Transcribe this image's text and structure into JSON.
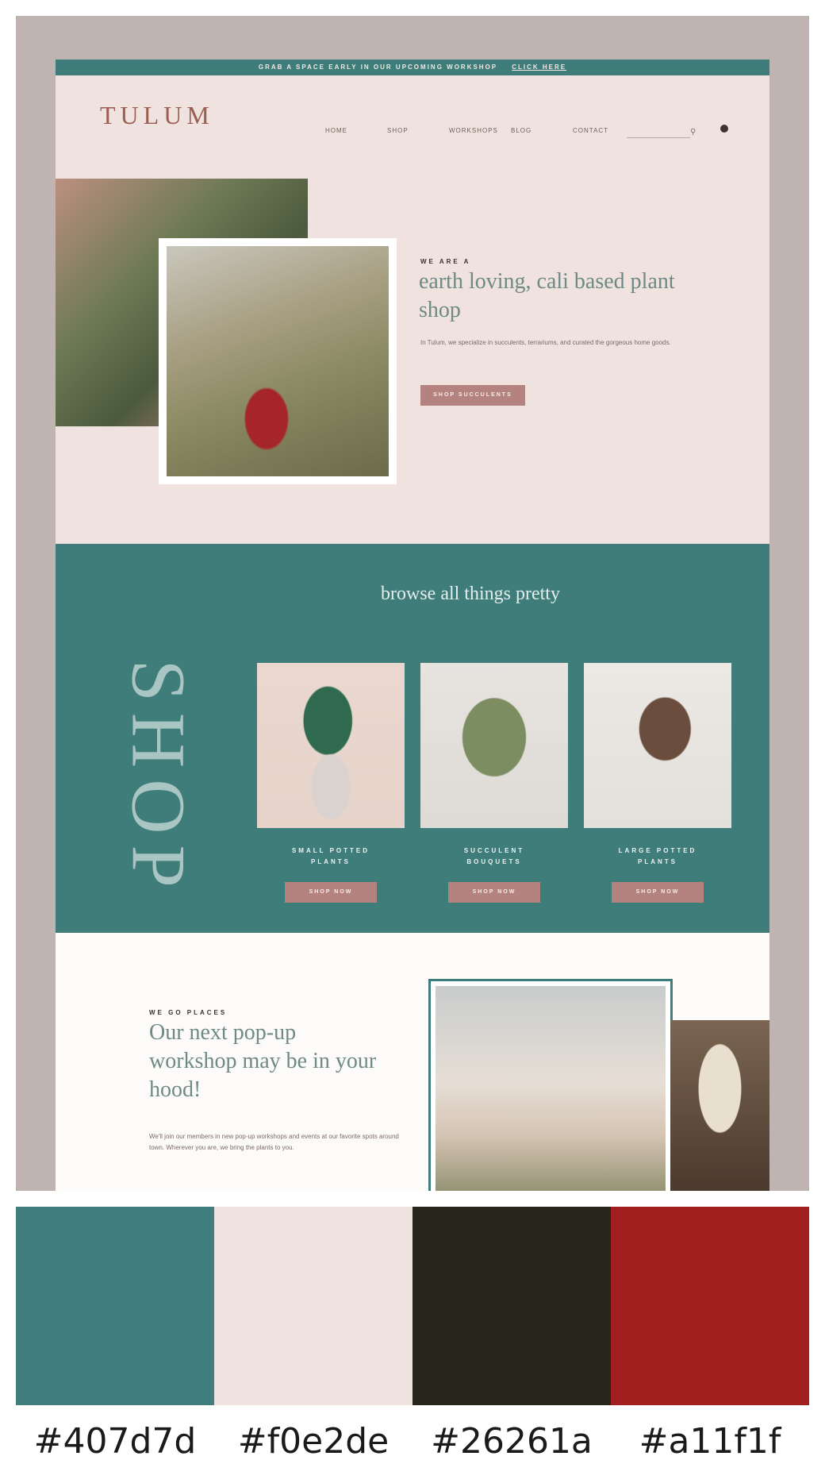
{
  "announcement": {
    "text": "GRAB A SPACE EARLY IN OUR UPCOMING WORKSHOP",
    "link": "CLICK HERE"
  },
  "header": {
    "logo": "TULUM",
    "nav": [
      "HOME",
      "SHOP",
      "WORKSHOPS",
      "BLOG",
      "CONTACT"
    ],
    "search_icon": "search-icon",
    "cart_icon": "cart-icon"
  },
  "hero": {
    "eyebrow": "WE ARE A",
    "title": "earth loving, cali based plant shop",
    "body": "In Tulum, we specialize in succulents, terrariums, and curated the gorgeous home goods.",
    "button": "SHOP SUCCULENTS"
  },
  "shop": {
    "vertical_label": "SHOP",
    "heading": "browse all things pretty",
    "products": [
      {
        "label": "SMALL POTTED\nPLANTS",
        "button": "SHOP NOW"
      },
      {
        "label": "SUCCULENT\nBOUQUETS",
        "button": "SHOP NOW"
      },
      {
        "label": "LARGE POTTED\nPLANTS",
        "button": "SHOP NOW"
      }
    ]
  },
  "workshop": {
    "eyebrow": "WE GO PLACES",
    "title": "Our next pop-up workshop may be in your hood!",
    "body": "We'll join our members in new pop-up workshops and events at our favorite spots around town. Wherever you are, we bring the plants to you."
  },
  "palette": [
    {
      "hex": "#407d7d",
      "color": "#407d7d"
    },
    {
      "hex": "#f0e2de",
      "color": "#f0e2de"
    },
    {
      "hex": "#26261a",
      "color": "#26261a"
    },
    {
      "hex": "#a11f1f",
      "color": "#a11f1f"
    }
  ]
}
